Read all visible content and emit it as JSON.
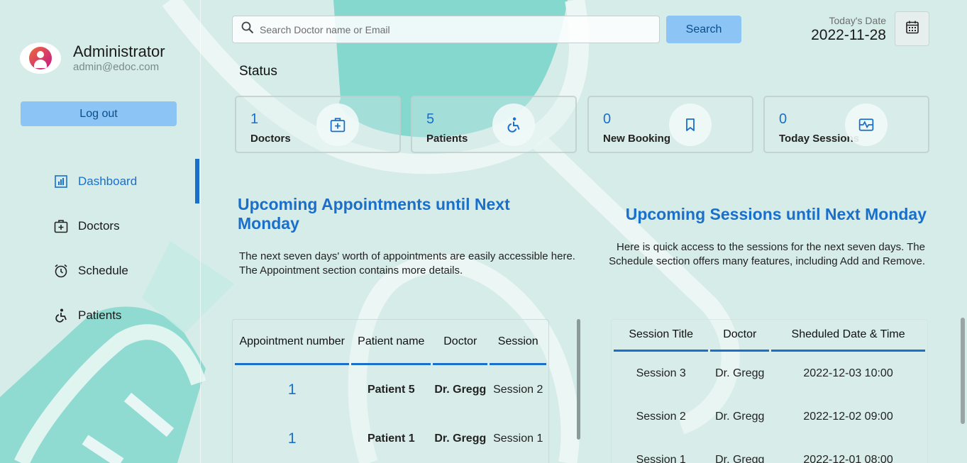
{
  "user": {
    "name": "Administrator",
    "email": "admin@edoc.com",
    "logout_label": "Log out"
  },
  "nav": {
    "items": [
      {
        "label": "Dashboard",
        "icon": "dashboard-icon",
        "active": true
      },
      {
        "label": "Doctors",
        "icon": "doctor-kit-icon",
        "active": false
      },
      {
        "label": "Schedule",
        "icon": "alarm-clock-icon",
        "active": false
      },
      {
        "label": "Patients",
        "icon": "wheelchair-icon",
        "active": false
      }
    ]
  },
  "search": {
    "placeholder": "Search Doctor name or Email",
    "value": "",
    "button_label": "Search"
  },
  "date": {
    "label": "Today's Date",
    "value": "2022-11-28"
  },
  "status": {
    "title": "Status",
    "cards": [
      {
        "count": "1",
        "label": "Doctors",
        "icon": "doctor-kit-icon"
      },
      {
        "count": "5",
        "label": "Patients",
        "icon": "wheelchair-icon"
      },
      {
        "count": "0",
        "label": "New Booking",
        "icon": "bookmark-icon"
      },
      {
        "count": "0",
        "label": "Today Sessions",
        "icon": "session-icon"
      }
    ]
  },
  "appointments": {
    "title": "Upcoming Appointments until Next Monday",
    "desc_line1": "The next seven days' worth of appointments are easily accessible here.",
    "desc_line2": "The Appointment section contains more details.",
    "headers": [
      "Appointment number",
      "Patient name",
      "Doctor",
      "Session"
    ],
    "rows": [
      {
        "number": "1",
        "patient": "Patient 5",
        "doctor": "Dr. Gregg",
        "session": "Session 2"
      },
      {
        "number": "1",
        "patient": "Patient 1",
        "doctor": "Dr. Gregg",
        "session": "Session 1"
      }
    ]
  },
  "sessions": {
    "title": "Upcoming Sessions until Next Monday",
    "desc": "Here is quick access to the sessions for the next seven days. The Schedule section offers many features, including Add and Remove.",
    "headers": [
      "Session Title",
      "Doctor",
      "Sheduled Date & Time"
    ],
    "rows": [
      {
        "title": "Session 3",
        "doctor": "Dr. Gregg",
        "datetime": "2022-12-03 10:00"
      },
      {
        "title": "Session 2",
        "doctor": "Dr. Gregg",
        "datetime": "2022-12-02 09:00"
      },
      {
        "title": "Session 1",
        "doctor": "Dr. Gregg",
        "datetime": "2022-12-01 08:00"
      }
    ]
  },
  "colors": {
    "accent": "#1a6fca",
    "button_bg": "#8cc4f5",
    "background": "#d6ece8",
    "decor_teal": "#6dd1c3"
  }
}
